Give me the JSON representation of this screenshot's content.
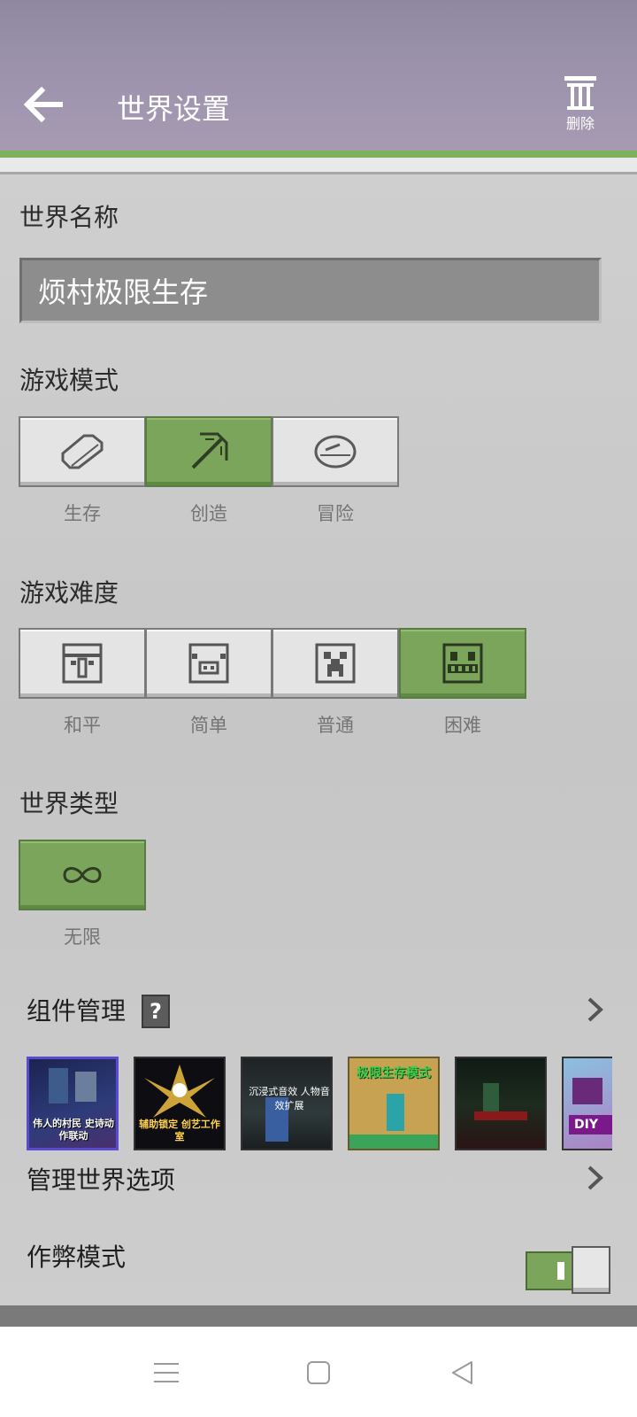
{
  "header": {
    "title": "世界设置",
    "back_icon": "arrow-left-icon",
    "delete_label": "删除",
    "delete_icon": "trash-icon"
  },
  "world_name": {
    "label": "世界名称",
    "value": "烦村极限生存"
  },
  "game_mode": {
    "label": "游戏模式",
    "options": [
      {
        "label": "生存",
        "icon": "bread-icon",
        "selected": false
      },
      {
        "label": "创造",
        "icon": "pickaxe-icon",
        "selected": true
      },
      {
        "label": "冒险",
        "icon": "compass-icon",
        "selected": false
      }
    ]
  },
  "difficulty": {
    "label": "游戏难度",
    "options": [
      {
        "label": "和平",
        "icon": "villager-face-icon",
        "selected": false
      },
      {
        "label": "简单",
        "icon": "pig-face-icon",
        "selected": false
      },
      {
        "label": "普通",
        "icon": "creeper-face-icon",
        "selected": false
      },
      {
        "label": "困难",
        "icon": "zombie-face-icon",
        "selected": true
      }
    ]
  },
  "world_type": {
    "label": "世界类型",
    "options": [
      {
        "label": "无限",
        "icon": "infinity-icon",
        "selected": true
      }
    ]
  },
  "addons": {
    "label": "组件管理",
    "help_glyph": "?",
    "thumbnails": [
      {
        "name": "villager-action-addon",
        "text": "伟人的村民 史诗动作联动"
      },
      {
        "name": "aim-lock-addon",
        "text": "辅助锁定 创艺工作室"
      },
      {
        "name": "immersive-sound-addon",
        "text": "沉浸式音效 人物音效扩展"
      },
      {
        "name": "hardcore-survival-addon",
        "text": "极限生存模式"
      },
      {
        "name": "zombie-night-addon",
        "text": ""
      },
      {
        "name": "diy-addon",
        "text": "DIY"
      }
    ]
  },
  "manage_world_options": {
    "label": "管理世界选项"
  },
  "cheats": {
    "label": "作弊模式",
    "enabled": true
  },
  "colors": {
    "accent_green": "#7ba55b",
    "header_purple": "#9c92ac"
  }
}
